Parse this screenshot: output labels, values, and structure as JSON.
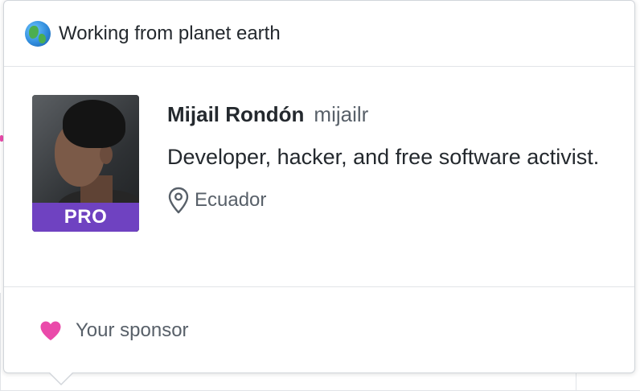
{
  "status": {
    "emoji_icon": "earth-globe-icon",
    "message": "Working from planet earth"
  },
  "profile": {
    "avatar_badge": "PRO",
    "name": "Mijail Rondón",
    "login": "mijailr",
    "bio": "Developer, hacker, and free software activist.",
    "location_icon": "location-pin-icon",
    "location": "Ecuador"
  },
  "footer": {
    "heart_icon": "heart-icon",
    "label": "Your sponsor"
  },
  "colors": {
    "pro_badge": "#6f42c1",
    "heart": "#ea4aaa",
    "text_primary": "#24292e",
    "text_secondary": "#586069",
    "border": "#e1e4e8"
  }
}
